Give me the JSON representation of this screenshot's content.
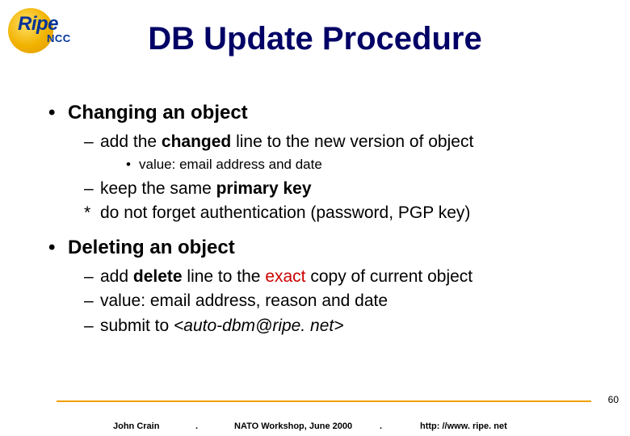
{
  "logo": {
    "brand": "Ripe",
    "sub": "NCC"
  },
  "title": "DB Update Procedure",
  "sections": [
    {
      "heading": "Changing an object",
      "items": [
        {
          "marker": "–",
          "html": "add the <b>changed</b> line to the new version of object",
          "sub": [
            {
              "marker": "•",
              "text": "value: email address and date"
            }
          ]
        },
        {
          "marker": "–",
          "html": "keep the same <b>primary key</b>"
        },
        {
          "marker": "*",
          "html": "do not forget authentication (password, PGP key)"
        }
      ]
    },
    {
      "heading": "Deleting an object",
      "items": [
        {
          "marker": "–",
          "html": "add <b>delete</b> line to the <span style='color:#cc0000'>exact</span> copy of current object"
        },
        {
          "marker": "–",
          "html": "value: email address, reason and date"
        },
        {
          "marker": "–",
          "html": "submit to <i>&lt;auto-dbm@ripe. net&gt;</i>"
        }
      ]
    }
  ],
  "footer": {
    "author": "John Crain",
    "sep": ".",
    "event": "NATO Workshop, June 2000",
    "url": "http: //www. ripe. net"
  },
  "page": "60"
}
